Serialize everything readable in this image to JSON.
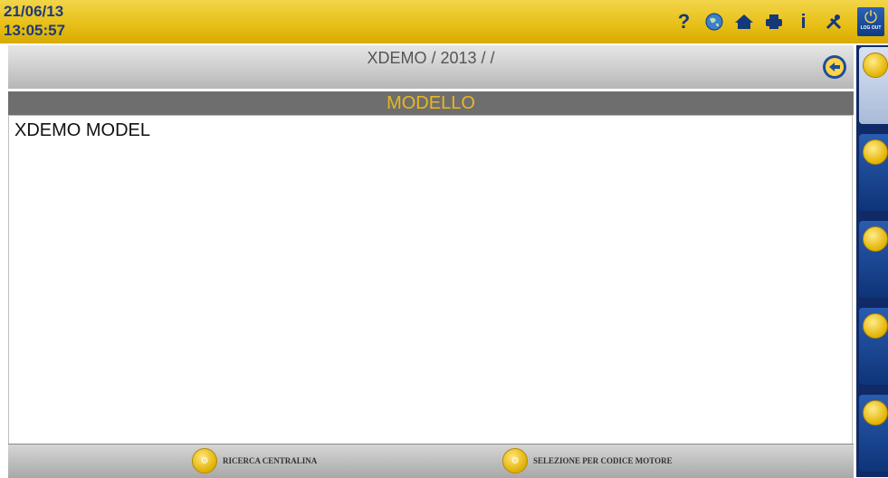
{
  "topbar": {
    "date": "21/06/13",
    "time": "13:05:57",
    "icons": [
      "help-icon",
      "globe-icon",
      "home-icon",
      "print-icon",
      "info-icon",
      "tools-icon"
    ],
    "help_glyph": "?",
    "info_glyph": "i",
    "logout_label": "LOG OUT"
  },
  "breadcrumb": "XDEMO / 2013 /  /",
  "section": {
    "title": "MODELLO"
  },
  "list": {
    "items": [
      "XDEMO MODEL"
    ]
  },
  "bottom": {
    "buttons": [
      {
        "label": "RICERCA CENTRALINA"
      },
      {
        "label": "SELEZIONE PER CODICE MOTORE"
      }
    ]
  },
  "sidebar": {
    "icons": [
      "diagnosis-icon",
      "service-icon",
      "signal-icon",
      "gauge-icon",
      "flag-icon"
    ]
  },
  "colors": {
    "accent": "#e8b820",
    "header_bg": "#6e6e6e",
    "brand_blue": "#14387a"
  }
}
